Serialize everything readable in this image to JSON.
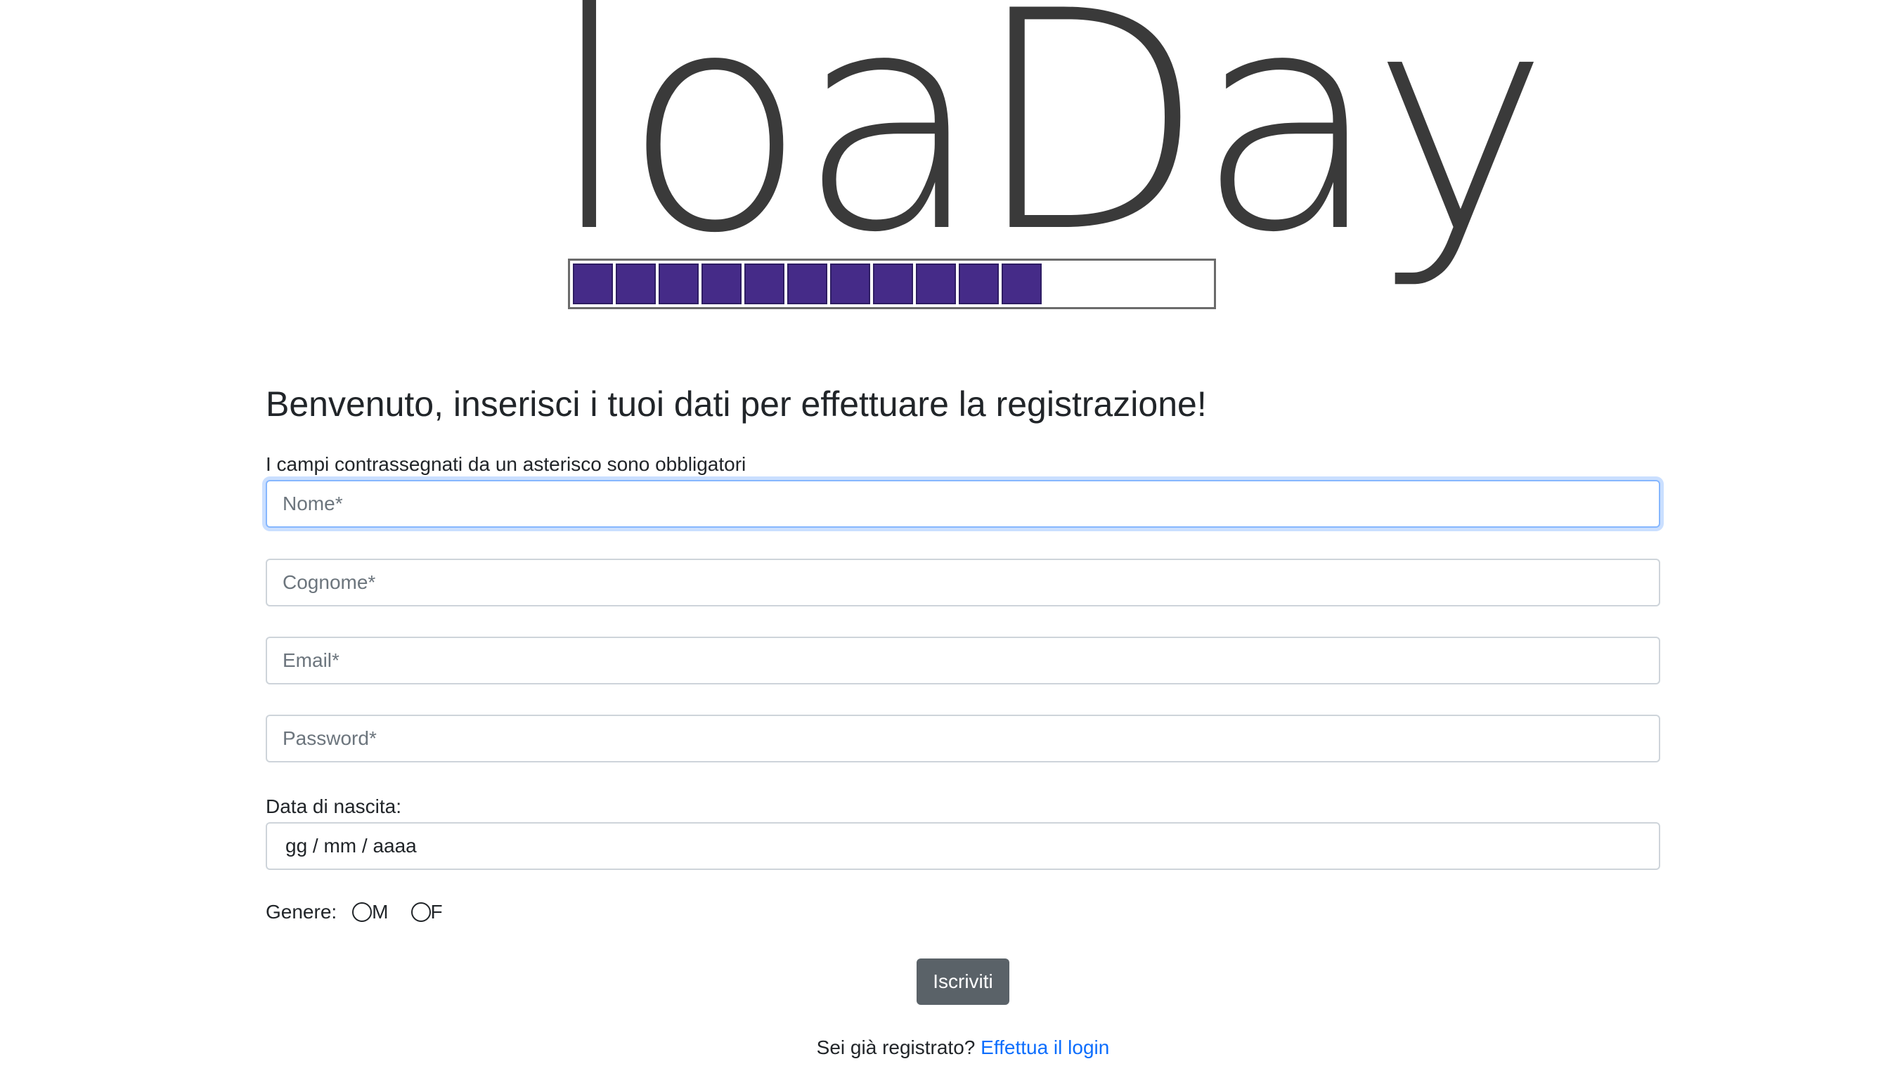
{
  "logo": {
    "wordmark": "loaDay",
    "progress_blocks_filled": 11,
    "progress_color": "#452b88"
  },
  "form": {
    "heading": "Benvenuto, inserisci i tuoi dati per effettuare la registrazione!",
    "note": "I campi contrassegnati da un asterisco sono obbligatori",
    "fields": {
      "nome_placeholder": "Nome*",
      "cognome_placeholder": "Cognome*",
      "email_placeholder": "Email*",
      "password_placeholder": "Password*"
    },
    "birthdate": {
      "label": "Data di nascita:",
      "placeholder": "gg / mm / aaaa"
    },
    "gender": {
      "label": "Genere:",
      "option_m": "M",
      "option_f": "F"
    },
    "submit_label": "Iscriviti",
    "login": {
      "prompt": "Sei già registrato?",
      "link_label": "Effettua il login"
    }
  },
  "colors": {
    "accent": "#0d6efd",
    "button": "#5a6268",
    "focus_ring": "#86b7fe"
  }
}
